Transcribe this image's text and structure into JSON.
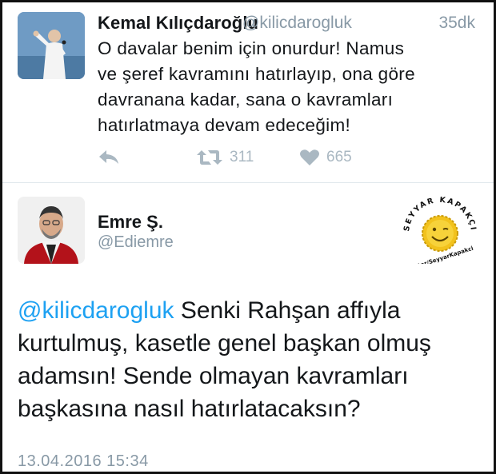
{
  "tweet1": {
    "author_name": "Kemal Kılıçdaroğlu",
    "handle": "@kilicdarogluk",
    "time": "35dk",
    "text_line1": "O davalar benim için onurdur! Namus",
    "text_line2": "ve şeref kavramını hatırlayıp, ona göre",
    "text_line3": "davranana kadar, sana o kavramları",
    "text_line4": "hatırlatmaya devam edeceğim!",
    "retweet_count": "311",
    "like_count": "665",
    "icons": [
      "reply-icon",
      "retweet-icon",
      "heart-icon"
    ]
  },
  "tweet2": {
    "author_name": "Emre Ş.",
    "handle": "@Ediemre",
    "mention": "@kilicdarogluk",
    "text_line1_rest": " Senki Rahşan affıyla",
    "text_line2": "kurtulmuş, kasetle genel başkan olmuş",
    "text_line3": "adamsın! Sende olmayan kavramları",
    "text_line4": "başkasına nasıl hatırlatacaksın?",
    "date": "13.04.2016 15:34"
  },
  "watermark": {
    "arc_text": "SEYYAR KAPAKÇI",
    "side_text": "Twitter/SeyyarKapakci"
  },
  "colors": {
    "mention": "#1da1f2",
    "meta_gray": "#8899a6",
    "action_gray": "#aab8c2",
    "badge_yellow": "#f2c21d"
  }
}
